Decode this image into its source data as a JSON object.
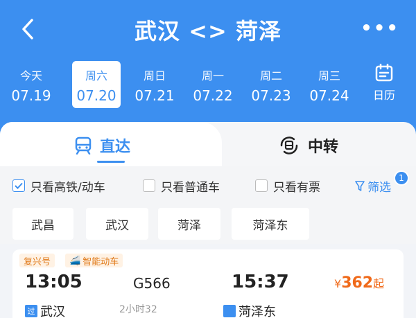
{
  "header": {
    "title": "武汉 <> 菏泽",
    "more": "•••",
    "calendar_label": "日历"
  },
  "dates": [
    {
      "weekday": "今天",
      "date": "07.19"
    },
    {
      "weekday": "周六",
      "date": "07.20"
    },
    {
      "weekday": "周日",
      "date": "07.21"
    },
    {
      "weekday": "周一",
      "date": "07.22"
    },
    {
      "weekday": "周二",
      "date": "07.23"
    },
    {
      "weekday": "周三",
      "date": "07.24"
    }
  ],
  "tabs": {
    "direct": "直达",
    "transfer": "中转"
  },
  "filters": {
    "high_speed": "只看高铁/动车",
    "normal": "只看普通车",
    "available": "只看有票",
    "filter_btn": "筛选",
    "badge_count": "1"
  },
  "stations": [
    "武昌",
    "武汉",
    "菏泽",
    "菏泽东"
  ],
  "train": {
    "tags": [
      "复兴号",
      "智能动车"
    ],
    "dep_time": "13:05",
    "number": "G566",
    "arr_time": "15:37",
    "price_symbol": "¥",
    "price": "362",
    "price_suffix": "起",
    "dep_tag": "过",
    "dep_station": "武汉",
    "duration": "2小时32",
    "arr_station": "菏泽东"
  },
  "colors": {
    "primary": "#3c8ff0",
    "price": "#f06a1a",
    "tag_bg": "#fff2e4",
    "tag_text": "#e07a1a"
  }
}
